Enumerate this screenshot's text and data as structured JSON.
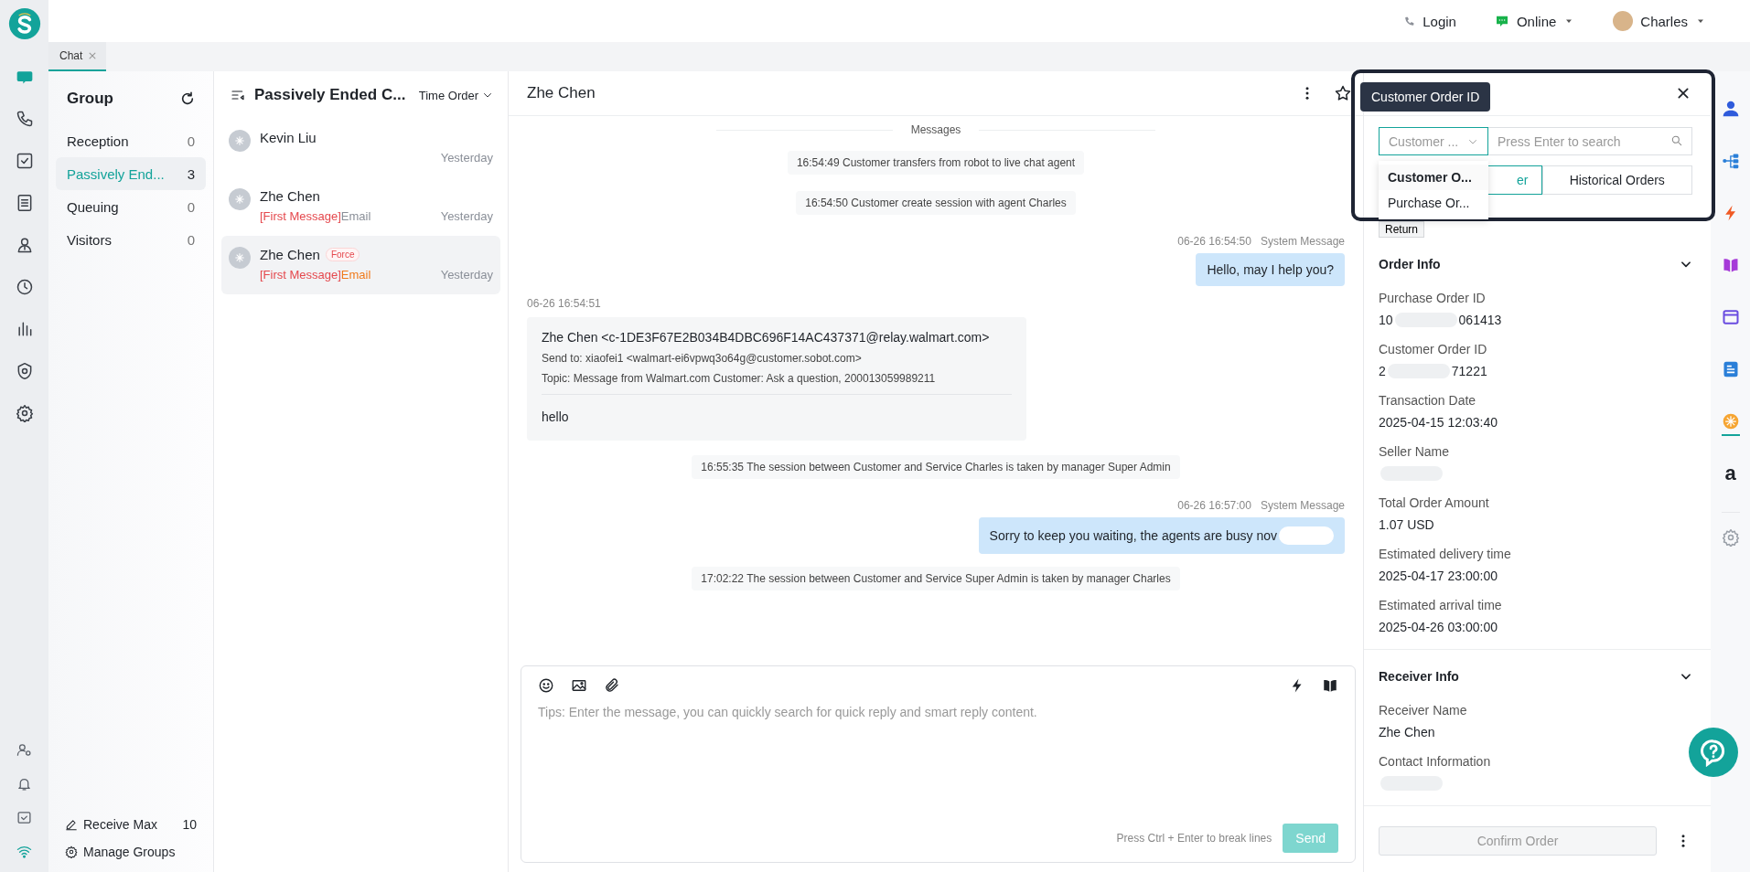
{
  "topbar": {
    "login": "Login",
    "status": "Online",
    "user": "Charles"
  },
  "tabs": [
    {
      "label": "Chat",
      "selected": true
    }
  ],
  "left_rail": {
    "items": [
      {
        "kind": "chat",
        "selected": true
      },
      {
        "kind": "phone",
        "selected": false
      },
      {
        "kind": "task",
        "selected": false
      },
      {
        "kind": "document",
        "selected": false
      },
      {
        "kind": "contact",
        "selected": false
      },
      {
        "kind": "clock",
        "selected": false
      },
      {
        "kind": "chart",
        "selected": false
      },
      {
        "kind": "shield",
        "selected": false
      },
      {
        "kind": "gear",
        "selected": false
      }
    ],
    "bottom": [
      {
        "kind": "user-settings",
        "selected": false
      },
      {
        "kind": "bell",
        "selected": false
      },
      {
        "kind": "inbox",
        "selected": false
      },
      {
        "kind": "wifi",
        "selected": true
      }
    ]
  },
  "group": {
    "title": "Group",
    "items": [
      {
        "name": "Reception",
        "count": "0",
        "selected": false
      },
      {
        "name": "Passively End...",
        "count": "3",
        "selected": true
      },
      {
        "name": "Queuing",
        "count": "0",
        "selected": false
      },
      {
        "name": "Visitors",
        "count": "0",
        "selected": false
      }
    ],
    "receive_max": {
      "label": "Receive Max",
      "value": "10"
    },
    "manage": "Manage Groups"
  },
  "conversations": {
    "title": "Passively Ended C...",
    "sort": "Time Order",
    "items": [
      {
        "name": "Kevin Liu",
        "time": "Yesterday",
        "selected": false
      },
      {
        "name": "Zhe Chen",
        "preview": [
          {
            "text": "[First Message]",
            "color": "#e5484d"
          },
          {
            "text": "Email",
            "color": "#8a8f98"
          }
        ],
        "time": "Yesterday",
        "selected": false
      },
      {
        "name": "Zhe Chen",
        "badge": "Force",
        "preview": [
          {
            "text": "[First Message]",
            "color": "#e5484d"
          },
          {
            "text": "Email",
            "color": "#f07a1a"
          }
        ],
        "time": "Yesterday",
        "selected": true
      }
    ]
  },
  "chat": {
    "title": "Zhe Chen",
    "messages": [
      {
        "kind": "divider",
        "text": "Messages"
      },
      {
        "kind": "system",
        "text": "16:54:49 Customer transfers from robot to live chat agent"
      },
      {
        "kind": "system",
        "text": "16:54:50 Customer create session with agent Charles"
      },
      {
        "kind": "agent",
        "time": "06-26 16:54:50",
        "sender": "System Message",
        "text": "Hello, may I help you?",
        "redacted": false
      },
      {
        "kind": "email",
        "time": "06-26 16:54:51",
        "from": "Zhe Chen <c-1DE3F67E2B034B4DBC696F14AC437371@relay.walmart.com>",
        "to": "Send to: xiaofei1 <walmart-ei6vpwq3o64g@customer.sobot.com>",
        "topic": "Topic: Message from Walmart.com Customer:  Ask a question, 200013059989211",
        "body": "hello"
      },
      {
        "kind": "system",
        "text": "16:55:35 The session between Customer and Service Charles is taken by manager Super Admin"
      },
      {
        "kind": "agent",
        "time": "06-26 16:57:00",
        "sender": "System Message",
        "text": "Sorry to keep you waiting, the agents are busy nov",
        "redacted": true
      },
      {
        "kind": "system",
        "text": "17:02:22 The session between Customer and Service Super Admin is taken by manager Charles"
      }
    ],
    "input": {
      "placeholder": "Tips: Enter the message, you can quickly search for quick reply and smart reply content.",
      "hint": "Press Ctrl + Enter to break lines",
      "send": "Send"
    }
  },
  "order_panel": {
    "tooltip": "Customer Order ID",
    "search_type": "Customer ...",
    "search_placeholder": "Press Enter to search",
    "dropdown": [
      {
        "label": "Customer O...",
        "selected": true
      },
      {
        "label": "Purchase Or...",
        "selected": false
      }
    ],
    "tabs": [
      {
        "label": "er",
        "selected": true
      },
      {
        "label": "Historical Orders",
        "selected": false
      }
    ],
    "return": "Return",
    "sections": [
      {
        "title": "Order Info",
        "expanded": true,
        "fields": [
          {
            "label": "Purchase Order ID",
            "value": [
              "10",
              "061413"
            ]
          },
          {
            "label": "Customer Order ID",
            "value": [
              "2",
              "71221"
            ]
          },
          {
            "label": "Transaction Date",
            "value": [
              "2025-04-15 12:03:40"
            ]
          },
          {
            "label": "Seller Name",
            "redacted": true
          },
          {
            "label": "Total Order Amount",
            "value": [
              "1.07 USD"
            ]
          },
          {
            "label": "Estimated delivery time",
            "value": [
              "2025-04-17 23:00:00"
            ]
          },
          {
            "label": "Estimated arrival time",
            "value": [
              "2025-04-26 03:00:00"
            ]
          }
        ]
      },
      {
        "title": "Receiver Info",
        "expanded": true,
        "fields": [
          {
            "label": "Receiver Name",
            "value": [
              "Zhe Chen"
            ]
          },
          {
            "label": "Contact Information",
            "redacted": true
          }
        ]
      }
    ],
    "confirm": "Confirm Order"
  },
  "right_rail": [
    {
      "kind": "person",
      "selected": false
    },
    {
      "kind": "tree",
      "selected": false
    },
    {
      "kind": "bolt",
      "selected": false
    },
    {
      "kind": "book",
      "selected": false
    },
    {
      "kind": "window",
      "selected": false
    },
    {
      "kind": "doc",
      "selected": false
    },
    {
      "kind": "orange",
      "selected": true
    },
    {
      "kind": "amazon",
      "label": "a",
      "selected": false
    },
    {
      "kind": "gear",
      "selected": false
    }
  ]
}
